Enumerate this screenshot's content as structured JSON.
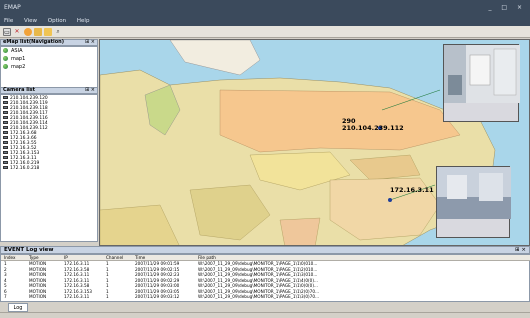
{
  "app": {
    "title": "EMAP",
    "window_controls": "_ □ ×"
  },
  "menu": [
    "File",
    "View",
    "Option",
    "Help"
  ],
  "toolbar_icons": [
    "new-icon",
    "delete-icon",
    "settings-icon",
    "camera-icon",
    "folder-icon",
    "search-icon"
  ],
  "nav_panel": {
    "title": "eMap list(Navigation)",
    "pin": "⊞ ×",
    "items": [
      "ASIA",
      "map1",
      "map2"
    ]
  },
  "camera_panel": {
    "title": "Camera list",
    "pin": "⊞ ×",
    "items": [
      "210.104.239.120",
      "210.104.239.119",
      "210.104.239.118",
      "210.104.239.117",
      "210.104.239.116",
      "210.104.239.114",
      "210.104.239.112",
      "172.16.3.68",
      "172.16.3.66",
      "172.16.3.55",
      "172.16.3.52",
      "172.16.3.153",
      "172.16.3.11",
      "172.16.0.219",
      "172.16.0.218"
    ]
  },
  "map_labels": {
    "ip_a_num": "290",
    "ip_a": "210.104.239.112",
    "ip_b": "172.16.3.11",
    "ip_b_num": "1"
  },
  "popups": [
    {
      "title": "IP:210.104.239.112 CH:1",
      "caption1": "[CH] 290",
      "caption2": "2007-11-29 오후 12:48:51"
    },
    {
      "title": "IP:172.16.3.11 CH:1",
      "caption1": "[CH] 172-1",
      "caption2": "2007-11-29 오후 12:31:27"
    }
  ],
  "event_log": {
    "title": "EVENT Log view",
    "controls": "⊞ ×",
    "columns": [
      "Index",
      "Type",
      "IP",
      "Channel",
      "Time",
      "File path"
    ],
    "rows": [
      [
        "1",
        "MOTION",
        "172.16.3.11",
        "1",
        "2007/11/29 09:01:59",
        "W:\\2007_11_29_09\\debug\\MONITOR_1\\PAGE_1\\1\\0(010..."
      ],
      [
        "2",
        "MOTION",
        "172.16.3.58",
        "1",
        "2007/11/29 09:02:15",
        "W:\\2007_11_29_09\\debug\\MONITOR_1\\PAGE_1\\1\\2(010..."
      ],
      [
        "3",
        "MOTION",
        "172.16.3.11",
        "1",
        "2007/11/29 09:02:23",
        "W:\\2007_11_29_09\\debug\\MONITOR_1\\PAGE_1\\1\\3(010..."
      ],
      [
        "4",
        "MOTION",
        "172.16.3.11",
        "1",
        "2007/11/29 09:02:29",
        "W:\\2007_11_29_09\\debug\\MONITOR_1\\PAGE_1\\1\\4(0(0)..."
      ],
      [
        "5",
        "MOTION",
        "172.16.3.58",
        "1",
        "2007/11/29 09:03:00",
        "W:\\2007_11_29_09\\debug\\MONITOR_1\\PAGE_1\\1\\0(0(0)..."
      ],
      [
        "6",
        "MOTION",
        "172.16.3.153",
        "1",
        "2007/11/29 09:03:05",
        "W:\\2007_11_29_09\\debug\\MONITOR_1\\PAGE_1\\1\\2(0)70..."
      ],
      [
        "7",
        "MOTION",
        "172.16.3.11",
        "1",
        "2007/11/29 09:03:12",
        "W:\\2007_11_29_09\\debug\\MONITOR_1\\PAGE_1\\1\\3(0)70..."
      ]
    ]
  },
  "log_tab": "Log",
  "colors": {
    "titlebar": "#3b4a5c",
    "popup_header": "#7b86c8",
    "ocean": "#a9d6ea",
    "land": "#e9e2b8"
  }
}
